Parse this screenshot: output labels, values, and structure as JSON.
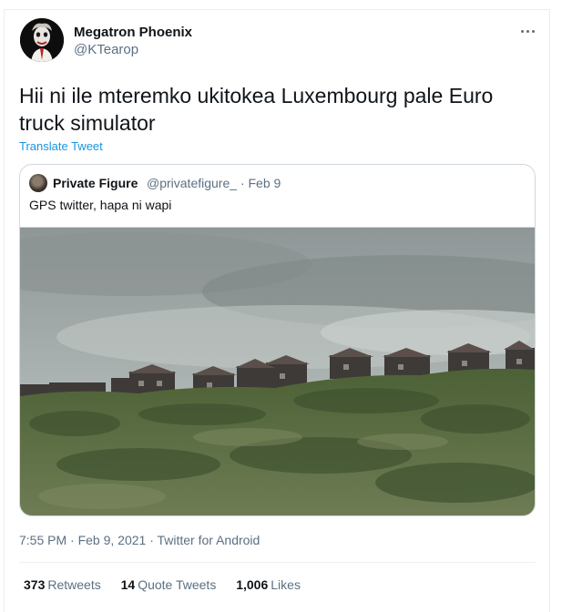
{
  "author": {
    "name": "Megatron Phoenix",
    "handle": "@KTearop"
  },
  "menu_icon": "more-dots-icon",
  "tweet": {
    "text": "Hii ni ile mteremko ukitokea Luxembourg pale Euro truck simulator",
    "translate_label": "Translate Tweet"
  },
  "quoted_tweet": {
    "name": "Private Figure",
    "handle": "@privatefigure_",
    "separator": "·",
    "date": "Feb 9",
    "text": "GPS twitter, hapa ni wapi"
  },
  "meta": {
    "timestamp": "7:55 PM · Feb 9, 2021 · Twitter for Android"
  },
  "stats": [
    {
      "count": "373",
      "label": "Retweets"
    },
    {
      "count": "14",
      "label": "Quote Tweets"
    },
    {
      "count": "1,006",
      "label": "Likes"
    }
  ],
  "colors": {
    "link": "#1b95e0",
    "secondary_text": "#5b7083",
    "primary_text": "#0f1419",
    "border": "#cfd9de"
  }
}
